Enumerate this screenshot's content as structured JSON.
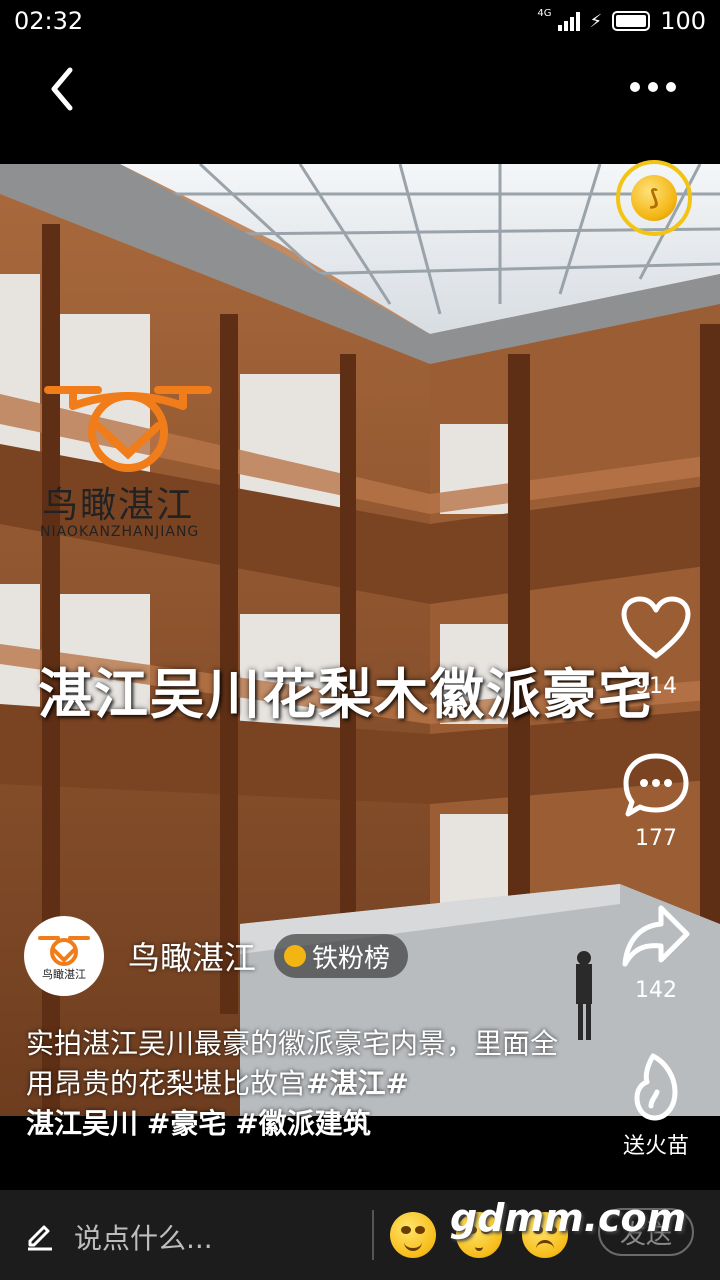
{
  "status_bar": {
    "time": "02:32",
    "network_type": "4G",
    "battery": "100"
  },
  "video": {
    "watermark_title": "鸟瞰湛江",
    "watermark_subtitle": "NIAOKANZHANJIANG",
    "overlay_title": "湛江吴川花梨木徽派豪宅"
  },
  "actions": {
    "like_count": "914",
    "comment_count": "177",
    "share_count": "142",
    "fire_label": "送火苗"
  },
  "author": {
    "name": "鸟瞰湛江",
    "avatar_text": "鸟瞰湛江",
    "fan_badge": "铁粉榜"
  },
  "caption": {
    "text": "实拍湛江吴川最豪的徽派豪宅内景，里面全用昂贵的花梨堪比故宫",
    "tags": [
      "#湛江#",
      "湛江吴川",
      "#豪宅",
      "#徽派建筑"
    ]
  },
  "bottom_bar": {
    "comment_placeholder": "说点什么...",
    "send_label": "发送",
    "site_watermark": "gdmm.com"
  },
  "colors": {
    "accent_gold": "#f2c413",
    "bar_bg": "#1c1c1c",
    "watermark_orange": "#f07d1a"
  }
}
